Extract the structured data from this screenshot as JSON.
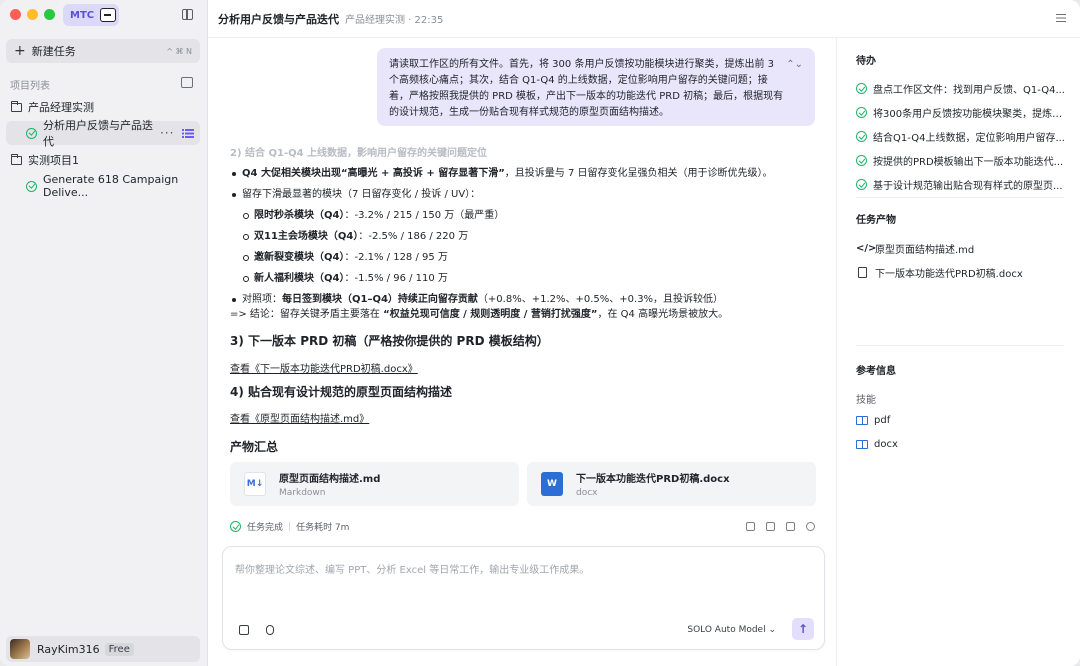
{
  "sidebar": {
    "brand": "MTC",
    "new_task": {
      "label": "新建任务",
      "shortcut": "^ ⌘ N"
    },
    "section_label": "项目列表",
    "projects": [
      {
        "label": "产品经理实测"
      },
      {
        "label": "分析用户反馈与产品迭代",
        "active": true
      },
      {
        "label": "实测项目1"
      },
      {
        "label": "Generate 618 Campaign Delive..."
      }
    ],
    "user": {
      "name": "RayKim316",
      "plan": "Free"
    }
  },
  "header": {
    "title": "分析用户反馈与产品迭代",
    "meta": "产品经理实测 · 22:35"
  },
  "chat": {
    "user_message": "请读取工作区的所有文件。首先，将 300 条用户反馈按功能模块进行聚类，提炼出前 3 个高频核心痛点；其次，结合 Q1-Q4 的上线数据，定位影响用户留存的关键问题；接着，严格按照我提供的 PRD 模板，产出下一版本的功能迭代 PRD 初稿；最后，根据现有的设计规范，生成一份贴合现有样式规范的原型页面结构描述。",
    "faded_heading": "2) 结合 Q1-Q4 上线数据，影响用户留存的关键问题定位",
    "bullet1_bold": "Q4 大促相关模块出现“高曝光 + 高投诉 + 留存显著下滑”",
    "bullet1_rest": "，且投诉量与 7 日留存变化呈强负相关（用于诊断优先级）。",
    "bullet2": "留存下滑最显著的模块（7 日留存变化 / 投诉 / UV）：",
    "sub_items": [
      {
        "name": "限时秒杀模块（Q4）",
        "value": "：-3.2% / 215 / 150 万（最严重）"
      },
      {
        "name": "双11主会场模块（Q4）",
        "value": "：-2.5% / 186 / 220 万"
      },
      {
        "name": "邀新裂变模块（Q4）",
        "value": "：-2.1% / 128 / 95 万"
      },
      {
        "name": "新人福利模块（Q4）",
        "value": "：-1.5% / 96 / 110 万"
      }
    ],
    "bullet3_prefix": "对照项：",
    "bullet3_bold": "每日签到模块（Q1–Q4）持续正向留存贡献",
    "bullet3_rest": "（+0.8%、+1.2%、+0.5%、+0.3%，且投诉较低）",
    "conclusion_prefix": "=> 结论：留存关键矛盾主要落在 ",
    "conclusion_bold": "“权益兑现可信度 / 规则透明度 / 营销打扰强度”",
    "conclusion_rest": "，在 Q4 高曝光场景被放大。",
    "h_prd": "3) 下一版本 PRD 初稿（严格按你提供的 PRD 模板结构）",
    "link_prd": "查看《下一版本功能迭代PRD初稿.docx》",
    "h_proto": "4) 贴合现有设计规范的原型页面结构描述",
    "link_proto": "查看《原型页面结构描述.md》",
    "h_artifacts": "产物汇总",
    "artifacts": [
      {
        "name": "原型页面结构描述.md",
        "type": "Markdown",
        "icon": "M↓"
      },
      {
        "name": "下一版本功能迭代PRD初稿.docx",
        "type": "docx",
        "icon": "W"
      }
    ],
    "status_done": "任务完成",
    "status_time": "任务耗时 7m"
  },
  "composer": {
    "placeholder": "帮你整理论文综述、编写 PPT、分析 Excel 等日常工作，输出专业级工作成果。",
    "model": "SOLO Auto Model"
  },
  "panel": {
    "todo_title": "待办",
    "todos": [
      "盘点工作区文件：找到用户反馈、Q1-Q4...",
      "将300条用户反馈按功能模块聚类，提炼T...",
      "结合Q1-Q4上线数据，定位影响用户留存...",
      "按提供的PRD模板输出下一版本功能迭代...",
      "基于设计规范输出贴合现有样式的原型页..."
    ],
    "products_title": "任务产物",
    "products": [
      "原型页面结构描述.md",
      "下一版本功能迭代PRD初稿.docx"
    ],
    "ref_title": "参考信息",
    "skills_label": "技能",
    "skills": [
      "pdf",
      "docx"
    ]
  },
  "colors": {
    "accent": "#5b4fd6",
    "success": "#21b26a",
    "bubble": "#e9e5fb"
  }
}
